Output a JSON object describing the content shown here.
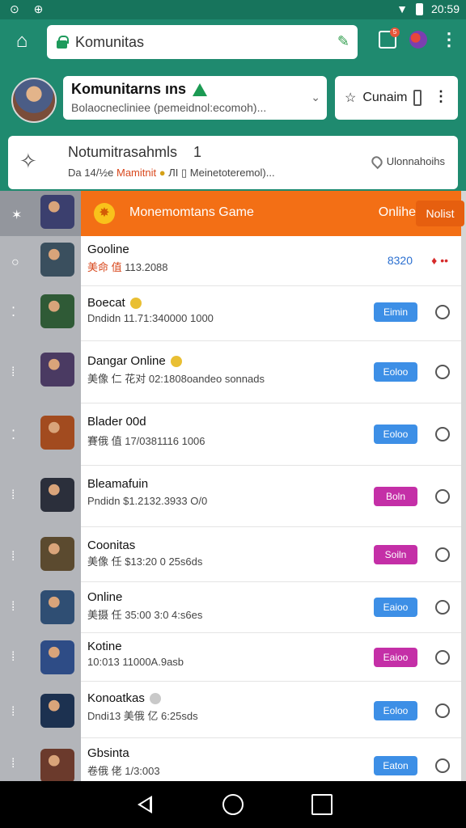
{
  "status_bar": {
    "left_icons": [
      "⊙",
      "⊕"
    ],
    "time": "20:59"
  },
  "browser": {
    "url_text": "Komunitas",
    "tab_count": "",
    "tab_badge": "5",
    "menu_icon": "⋮"
  },
  "community": {
    "title": "Komunitarns ıns",
    "subtitle": "Bolaocnecliniee (pemeidnol:ecomoh)...",
    "join_label": "Cunaim",
    "more_icon": "⋮"
  },
  "info": {
    "title": "Notumitrasahmls",
    "title_num": "1",
    "sub_prefix": "Da 14/½e",
    "sub_highlight": "Mamitnit",
    "sub_mid": "ЛI",
    "sub_suffix": "Meinetoteremol)...",
    "right_text": "Ulonnahoihs"
  },
  "featured": {
    "title": "Monemomtans Game",
    "status": "Onlihe",
    "button": "Nolist"
  },
  "rows": [
    {
      "title": "Goоline",
      "sub_hl": "美命 值",
      "sub": "113.2088",
      "score": "8320",
      "flag": "♦ ••",
      "button": "",
      "btn_color": ""
    },
    {
      "title": "Boecat",
      "sub_hl": "",
      "sub": "Dndidn 11.71:340000 1000",
      "score": "",
      "flag": "",
      "button": "Eimin",
      "btn_color": "#3d8fe6"
    },
    {
      "title": "Dangar Online",
      "sub_hl": "",
      "sub": "美像 仁 花对 02:1808oandeo sonnads",
      "score": "",
      "flag": "",
      "button": "Eoloo",
      "btn_color": "#3d8fe6"
    },
    {
      "title": "Blader 00d",
      "sub_hl": "",
      "sub": "賽俄 值 17/0381116 1006",
      "score": "",
      "flag": "",
      "button": "Eoloo",
      "btn_color": "#3d8fe6"
    },
    {
      "title": "Bleamafuin",
      "sub_hl": "",
      "sub": "Pndidn $1.2132.3933 O/0",
      "score": "",
      "flag": "",
      "button": "Boln",
      "btn_color": "#c42fa7"
    },
    {
      "title": "Coonitas",
      "sub_hl": "",
      "sub": "美像 任 $13:20 0 25s6ds",
      "score": "",
      "flag": "",
      "button": "Soiln",
      "btn_color": "#c42fa7"
    },
    {
      "title": "Online",
      "sub_hl": "",
      "sub": "美摄 任 35:00 3:0 4:s6es",
      "score": "",
      "flag": "",
      "button": "Eaioo",
      "btn_color": "#3d8fe6"
    },
    {
      "title": "Kotine",
      "sub_hl": "",
      "sub": "10:013 11000A.9asb",
      "score": "",
      "flag": "",
      "button": "Eaioo",
      "btn_color": "#c42fa7"
    },
    {
      "title": "Konoatkas",
      "sub_hl": "",
      "sub": "Dndi13 美俄 亿 6:25sds",
      "score": "",
      "flag": "",
      "button": "Eoloo",
      "btn_color": "#3d8fe6"
    },
    {
      "title": "Gbsinta",
      "sub_hl": "",
      "sub": "卷俄 佬 1/3:003",
      "score": "",
      "flag": "",
      "button": "Eaton",
      "btn_color": "#3d8fe6"
    }
  ],
  "game_icon_colors": [
    "#3b3f6e",
    "#3a4f5e",
    "#2f5a36",
    "#4a3a62",
    "#a24b1f",
    "#2b2f3b",
    "#5b4a2f",
    "#2f4e73",
    "#2e4c86",
    "#1c3150",
    "#6b3a2c"
  ]
}
